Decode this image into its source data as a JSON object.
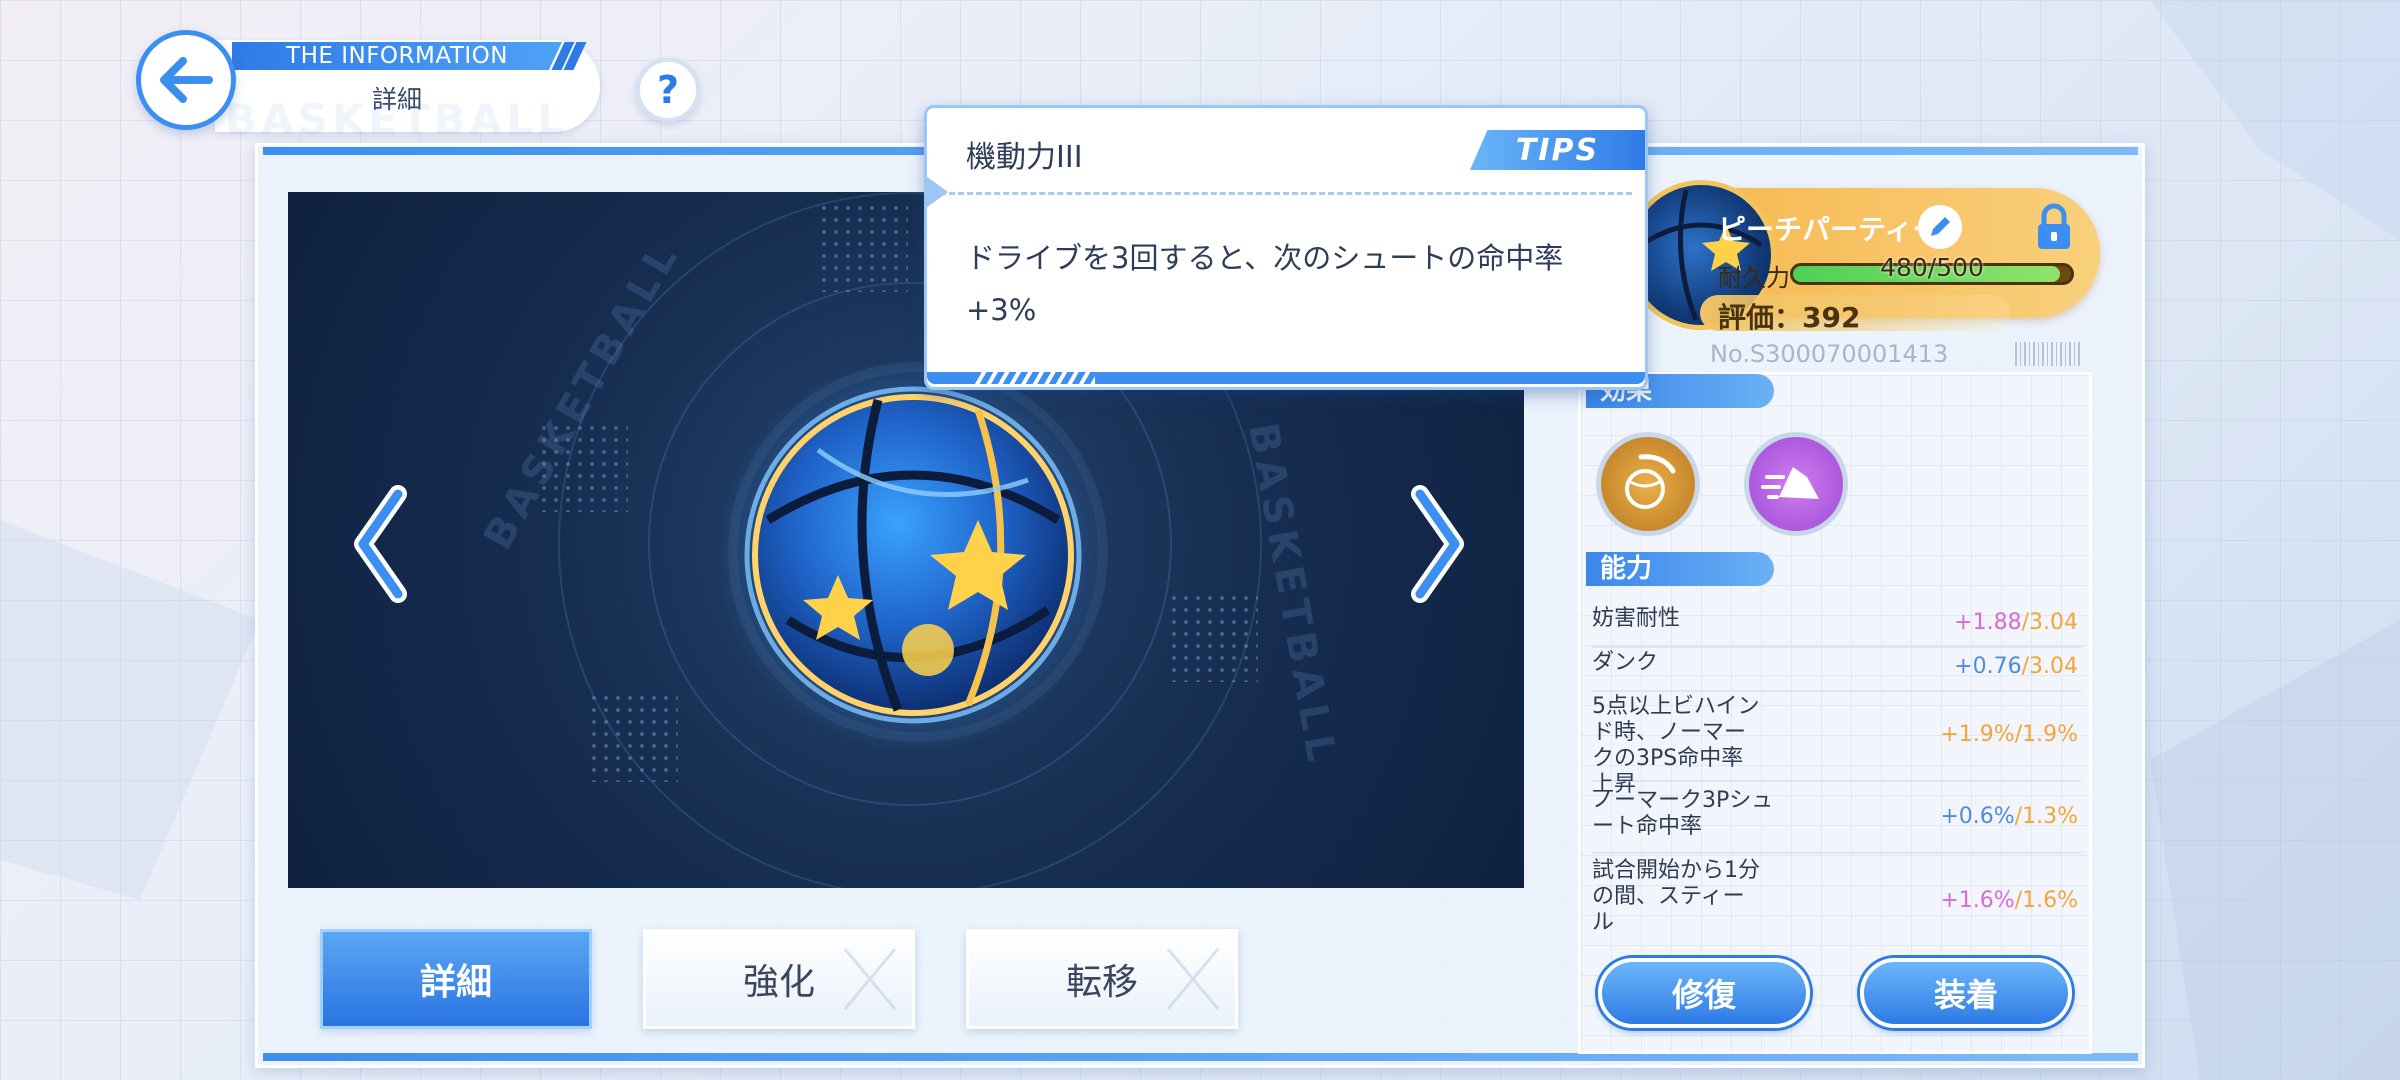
{
  "header": {
    "banner_title": "THE INFORMATION",
    "subtitle": "詳細",
    "background_word": "BASKETBALL",
    "help_symbol": "?"
  },
  "tooltip": {
    "badge": "TIPS",
    "title": "機動力III",
    "description": "ドライブを3回すると、次のシュートの命中率+3%"
  },
  "viewer": {
    "watermark_text": "BASKETBALL",
    "item_image": "star-basketball"
  },
  "tabs": [
    {
      "label": "詳細",
      "active": true
    },
    {
      "label": "強化",
      "active": false
    },
    {
      "label": "転移",
      "active": false
    }
  ],
  "card": {
    "name": "ピーチパーティー",
    "durability_label": "耐久力",
    "durability_text": "480/500",
    "durability_fraction": 0.96,
    "rating_label": "評価：",
    "rating_value": "392",
    "serial": "No.S300070001413",
    "effects_label": "効果",
    "ability_label": "能力",
    "effect_icons": [
      "basketball-shot-icon",
      "sneaker-speed-icon"
    ]
  },
  "stats": [
    {
      "name": "妨害耐性",
      "value": "+1.88",
      "max": "/3.04",
      "color": "pink"
    },
    {
      "name": "ダンク",
      "value": "+0.76",
      "max": "/3.04",
      "color": "blue"
    },
    {
      "name": "5点以上ビハインド時、ノーマークの3PS命中率上昇",
      "value": "+1.9%",
      "max": "/1.9%",
      "color": "orange"
    },
    {
      "name": "ノーマーク3Pシュート命中率",
      "value": "+0.6%",
      "max": "/1.3%",
      "color": "blue"
    },
    {
      "name": "試合開始から1分の間、スティール",
      "value": "+1.6%",
      "max": "/1.6%",
      "color": "pink"
    }
  ],
  "actions": {
    "repair": "修復",
    "equip": "装着"
  },
  "colors": {
    "accent_blue": "#2f7be6",
    "card_gold": "#f6b54a",
    "stat_pink": "#d96ad6",
    "stat_blue": "#4f8be0",
    "stat_orange": "#f5a43a"
  }
}
